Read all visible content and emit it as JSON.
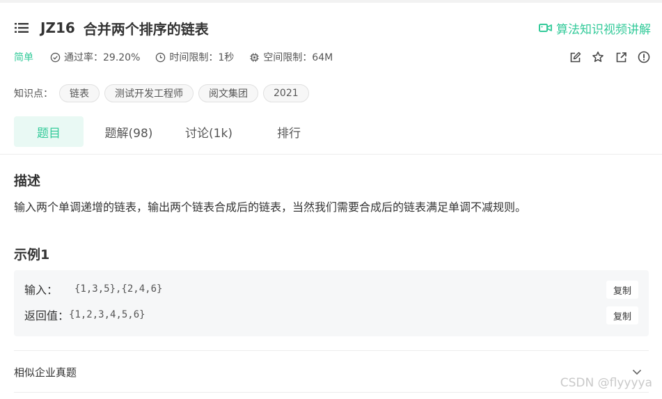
{
  "problem": {
    "id": "JZ16",
    "name": "合并两个排序的链表",
    "video_link_label": "算法知识视频讲解"
  },
  "meta": {
    "difficulty": "简单",
    "pass_rate": "通过率：29.20%",
    "time_limit": "时间限制：1秒",
    "memory_limit": "空间限制：64M",
    "action_icons": [
      "edit-icon",
      "star-icon",
      "share-icon",
      "report-icon"
    ]
  },
  "tags": {
    "label": "知识点：",
    "items": [
      "链表",
      "测试开发工程师",
      "阅文集团",
      "2021"
    ]
  },
  "tabs": [
    {
      "label": "题目",
      "active": true
    },
    {
      "label": "题解(98)",
      "active": false
    },
    {
      "label": "讨论(1k)",
      "active": false
    },
    {
      "label": "排行",
      "active": false
    }
  ],
  "description": {
    "heading": "描述",
    "text": "输入两个单调递增的链表，输出两个链表合成后的链表，当然我们需要合成后的链表满足单调不减规则。"
  },
  "example": {
    "heading": "示例1",
    "input_label": "输入：",
    "input_value": "{1,3,5},{2,4,6}",
    "output_label": "返回值：",
    "output_value": "{1,2,3,4,5,6}",
    "copy_label": "复制"
  },
  "similar": {
    "label": "相似企业真题"
  },
  "watermark": "CSDN @flyyyya",
  "colors": {
    "accent": "#32ca99",
    "tab_active_bg": "#e9f9f4",
    "example_bg": "#f6f7f8"
  }
}
